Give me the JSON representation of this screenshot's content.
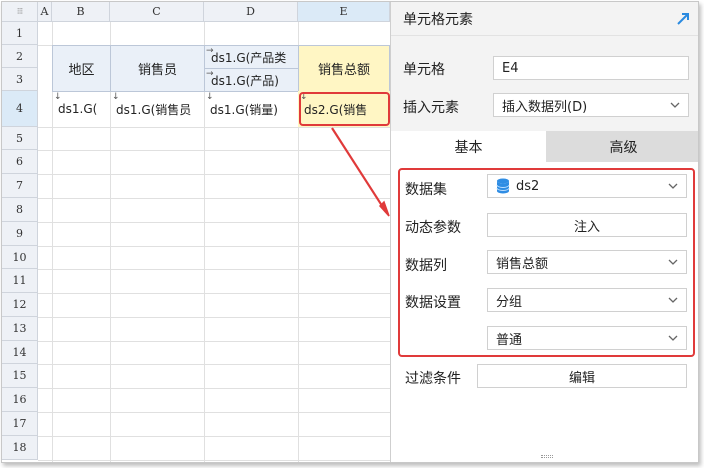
{
  "sheet": {
    "corner_icon": "grid-dots-icon",
    "columns": [
      "A",
      "B",
      "C",
      "D",
      "E"
    ],
    "rows": [
      "1",
      "2",
      "3",
      "4",
      "5",
      "6",
      "7",
      "8",
      "9",
      "10",
      "11",
      "12",
      "13",
      "14",
      "15",
      "16",
      "17",
      "18"
    ],
    "cells": {
      "B2": "地区",
      "C2": "销售员",
      "D2": "ds1.G(产品类",
      "D3": "ds1.G(产品)",
      "E2": "销售总额",
      "B4": "ds1.G(",
      "C4": "ds1.G(销售员",
      "D4": "ds1.G(销量)",
      "E4": "ds2.G(销售"
    },
    "selected_cell": "E4"
  },
  "panel": {
    "title": "单元格元素",
    "expand_icon": "expand-arrow-icon",
    "cell_label": "单元格",
    "cell_value": "E4",
    "insert_label": "插入元素",
    "insert_value": "插入数据列(D)",
    "tabs": [
      {
        "label": "基本",
        "active": true
      },
      {
        "label": "高级",
        "active": false
      }
    ],
    "dataset_label": "数据集",
    "dataset_value": "ds2",
    "dataset_icon": "database-icon",
    "param_label": "动态参数",
    "param_button": "注入",
    "column_label": "数据列",
    "column_value": "销售总额",
    "setting_label": "数据设置",
    "setting_value": "分组",
    "setting_sub_value": "普通",
    "filter_label": "过滤条件",
    "filter_button": "编辑"
  },
  "colors": {
    "highlight_red": "#e03a3a",
    "header_fill": "#eaf0f8",
    "selected_fill": "#fff6c4"
  }
}
